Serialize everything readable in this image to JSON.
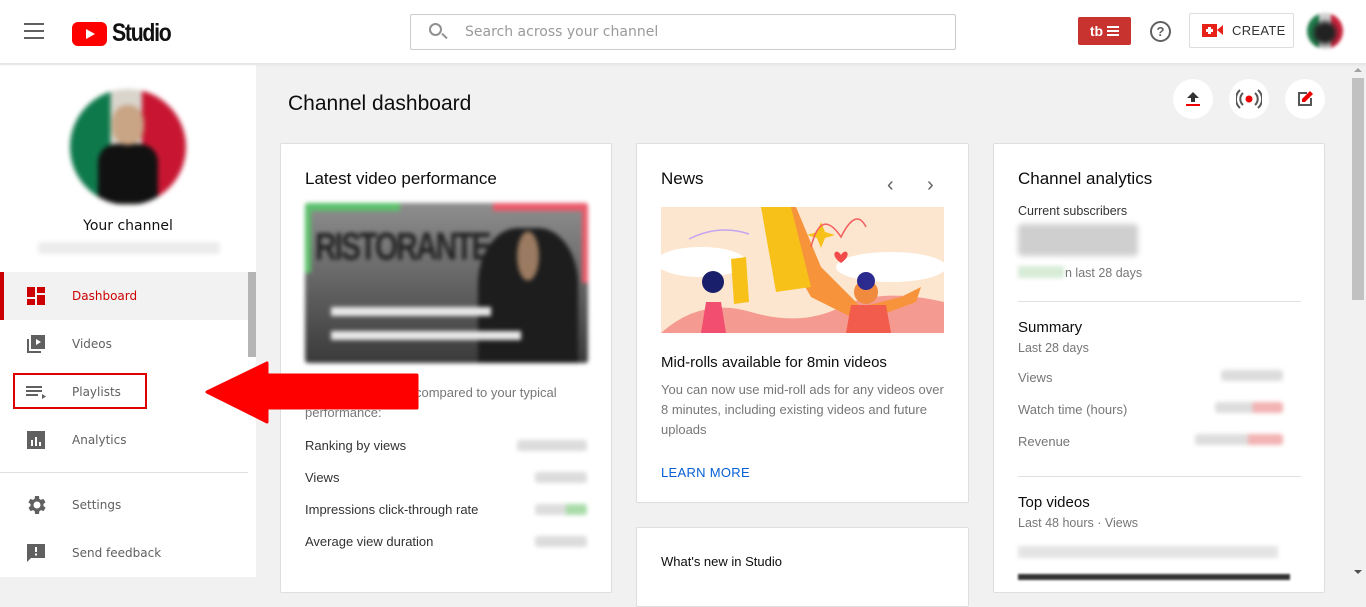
{
  "topbar": {
    "app_name": "Studio",
    "search_placeholder": "Search across your channel",
    "tubebuddy_label": "tb",
    "help_label": "?",
    "create_label": "CREATE"
  },
  "sidebar": {
    "channel_label": "Your channel",
    "items": [
      {
        "label": "Dashboard",
        "icon": "dashboard-icon",
        "active": true
      },
      {
        "label": "Videos",
        "icon": "videos-icon"
      },
      {
        "label": "Playlists",
        "icon": "playlists-icon",
        "highlighted": true
      },
      {
        "label": "Analytics",
        "icon": "analytics-icon"
      }
    ],
    "bottom_items": [
      {
        "label": "Settings",
        "icon": "gear-icon"
      },
      {
        "label": "Send feedback",
        "icon": "feedback-icon"
      }
    ]
  },
  "main": {
    "title": "Channel dashboard",
    "latest": {
      "title": "Latest video performance",
      "compare_text": "compared to your typical performance:",
      "metrics": [
        {
          "label": "Ranking by views"
        },
        {
          "label": "Views"
        },
        {
          "label": "Impressions click-through rate"
        },
        {
          "label": "Average view duration"
        }
      ]
    },
    "news": {
      "title": "News",
      "headline": "Mid-rolls available for 8min videos",
      "body": "You can now use mid-roll ads for any videos over 8 minutes, including existing videos and future uploads",
      "link": "LEARN MORE"
    },
    "whats_new": {
      "title": "What's new in Studio"
    },
    "analytics": {
      "title": "Channel analytics",
      "subscribers_label": "Current subscribers",
      "subscribers_suffix": "n last 28 days",
      "summary_title": "Summary",
      "summary_period": "Last 28 days",
      "summary_rows": [
        {
          "label": "Views"
        },
        {
          "label": "Watch time (hours)"
        },
        {
          "label": "Revenue"
        }
      ],
      "top_videos_title": "Top videos",
      "top_videos_period": "Last 48 hours · Views"
    }
  },
  "colors": {
    "brand_red": "#ff0000",
    "active_red": "#cc0000",
    "link_blue": "#065fd4",
    "tubebuddy": "#c8322f"
  }
}
